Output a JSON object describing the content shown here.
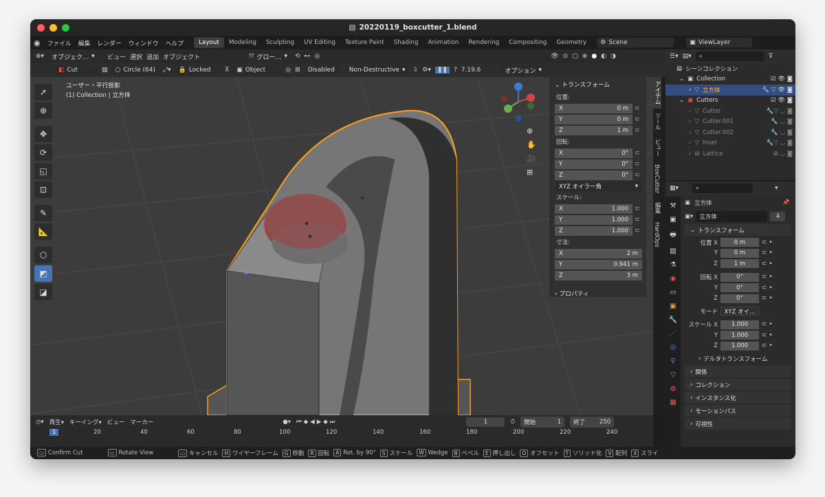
{
  "window": {
    "title": "20220119_boxcutter_1.blend"
  },
  "menu": [
    "ファイル",
    "編集",
    "レンダー",
    "ウィンドウ",
    "ヘルプ"
  ],
  "workspaces": [
    "Layout",
    "Modeling",
    "Sculpting",
    "UV Editing",
    "Texture Paint",
    "Shading",
    "Animation",
    "Rendering",
    "Compositing",
    "Geometry"
  ],
  "scene": "Scene",
  "view_layer": "ViewLayer",
  "vp_header": {
    "mode": "オブジェク…",
    "view": "ビュー",
    "select": "選択",
    "add": "追加",
    "object": "オブジェクト",
    "orient": "グロー…"
  },
  "tool_header": {
    "cut": "Cut",
    "circle": "Circle (64)",
    "locked": "Locked",
    "object": "Object",
    "disabled": "Disabled",
    "nd": "Non-Destructive",
    "version": "7.19.6",
    "options": "オプション"
  },
  "viewport": {
    "view_label": "ユーザー・平行投影",
    "collection_label": "(1) Collection | 立方体"
  },
  "npanel": {
    "transform": "トランスフォーム",
    "location": "位置:",
    "rotation": "回転:",
    "scale": "スケール:",
    "dimensions": "寸法:",
    "euler": "XYZ オイラー角",
    "properties": "プロパティ",
    "loc": [
      [
        "X",
        "0 m"
      ],
      [
        "Y",
        "0 m"
      ],
      [
        "Z",
        "1 m"
      ]
    ],
    "rot": [
      [
        "X",
        "0°"
      ],
      [
        "Y",
        "0°"
      ],
      [
        "Z",
        "0°"
      ]
    ],
    "scl": [
      [
        "X",
        "1.000"
      ],
      [
        "Y",
        "1.000"
      ],
      [
        "Z",
        "1.000"
      ]
    ],
    "dim": [
      [
        "X",
        "2 m"
      ],
      [
        "Y",
        "0.941 m"
      ],
      [
        "Z",
        "3 m"
      ]
    ]
  },
  "vtabs": [
    "アイテム",
    "ツール",
    "ビュー",
    "BoxCutter",
    "編集",
    "HardOps"
  ],
  "outliner": {
    "root": "シーンコレクション",
    "items": [
      "Collection",
      "立方体",
      "Cutters",
      "Cutter",
      "Cutter.001",
      "Cutter.002",
      "Inset",
      "Lattice"
    ]
  },
  "props": {
    "object_name": "立方体",
    "data_name": "立方体",
    "users": "4",
    "transform": "トランスフォーム",
    "loc_label": "位置 X",
    "rot_label": "回転 X",
    "scale_label": "スケール X",
    "mode_label": "モード",
    "mode": "XYZ オイ…",
    "loc": [
      "0 m",
      "0 m",
      "1 m"
    ],
    "rot": [
      "0°",
      "0°",
      "0°"
    ],
    "scl": [
      "1.000",
      "1.000",
      "1.000"
    ],
    "y": "Y",
    "z": "Z",
    "panels": [
      "デルタトランスフォーム",
      "関係",
      "コレクション",
      "インスタンス化",
      "モーションパス",
      "可視性"
    ]
  },
  "timeline": {
    "playback": "再生",
    "keying": "キーイング",
    "view": "ビュー",
    "marker": "マーカー",
    "frame": "1",
    "start_label": "開始",
    "start": "1",
    "end_label": "終了",
    "end": "250",
    "ticks": [
      "1",
      "20",
      "40",
      "60",
      "80",
      "100",
      "120",
      "140",
      "160",
      "180",
      "200",
      "220",
      "240"
    ]
  },
  "status": [
    [
      "",
      "Confirm Cut"
    ],
    [
      "",
      "Rotate View"
    ],
    [
      "",
      "キャンセル"
    ],
    [
      "H",
      "ワイヤーフレーム"
    ],
    [
      "G",
      "移動"
    ],
    [
      "R",
      "回転"
    ],
    [
      "A",
      "Rot. by 90°"
    ],
    [
      "S",
      "スケール"
    ],
    [
      "W",
      "Wedge"
    ],
    [
      "B",
      "ベベル"
    ],
    [
      "E",
      "押し出し"
    ],
    [
      "O",
      "オフセット"
    ],
    [
      "T",
      "ソリッド化"
    ],
    [
      "V",
      "配列"
    ],
    [
      "X",
      "スライ"
    ]
  ]
}
